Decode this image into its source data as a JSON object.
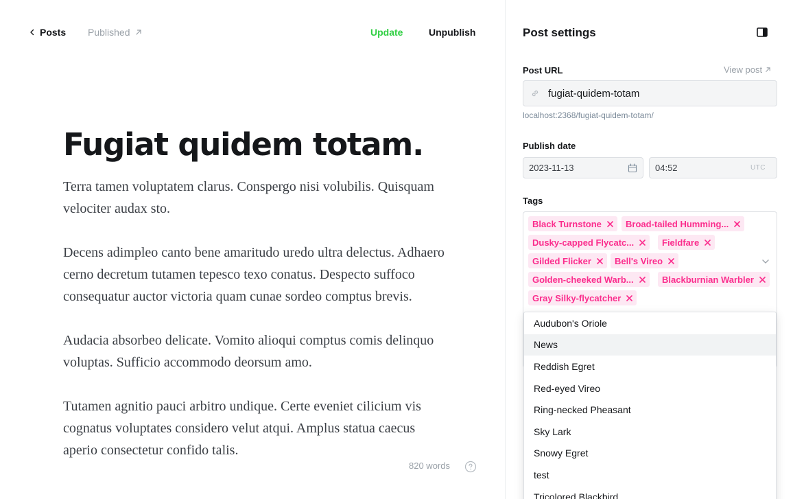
{
  "topbar": {
    "back_label": "Posts",
    "status_label": "Published",
    "update_label": "Update",
    "unpublish_label": "Unpublish"
  },
  "post": {
    "title": "Fugiat quidem totam.",
    "paragraphs": [
      "Terra tamen voluptatem clarus. Conspergo nisi volubilis. Quisquam velociter audax sto.",
      "Decens adimpleo canto bene amaritudo uredo ultra delectus. Adhaero cerno decretum tutamen tepesco texo conatus. Despecto suffoco consequatur auctor victoria quam cunae sordeo comptus brevis.",
      "Audacia absorbeo delicate. Vomito alioqui comptus comis delinquo voluptas. Sufficio accommodo deorsum amo.",
      "Tutamen agnitio pauci arbitro undique. Certe eveniet cilicium vis cognatus voluptates considero velut atqui. Amplus statua caecus aperio consectetur confido talis."
    ],
    "word_count": "820 words"
  },
  "settings": {
    "title": "Post settings",
    "post_url_label": "Post URL",
    "view_post_label": "View post",
    "slug": "fugiat-quidem-totam",
    "url_hint": "localhost:2368/fugiat-quidem-totam/",
    "publish_date_label": "Publish date",
    "date": "2023-11-13",
    "time": "04:52",
    "timezone": "UTC",
    "tags_label": "Tags",
    "tags": [
      "Black Turnstone",
      "Broad-tailed Humming...",
      "Dusky-capped Flycatc...",
      "Fieldfare",
      "Gilded Flicker",
      "Bell's Vireo",
      "Golden-cheeked Warb...",
      "Blackburnian Warbler",
      "Gray Silky-flycatcher"
    ],
    "dropdown_options": [
      "Audubon's Oriole",
      "News",
      "Reddish Egret",
      "Red-eyed Vireo",
      "Ring-necked Pheasant",
      "Sky Lark",
      "Snowy Egret",
      "test",
      "Tricolored Blackbird"
    ],
    "highlighted_option": "News"
  },
  "colors": {
    "accent_green": "#30cf43",
    "tag_text": "#fb2d8d",
    "tag_bg": "#fde8f3"
  }
}
